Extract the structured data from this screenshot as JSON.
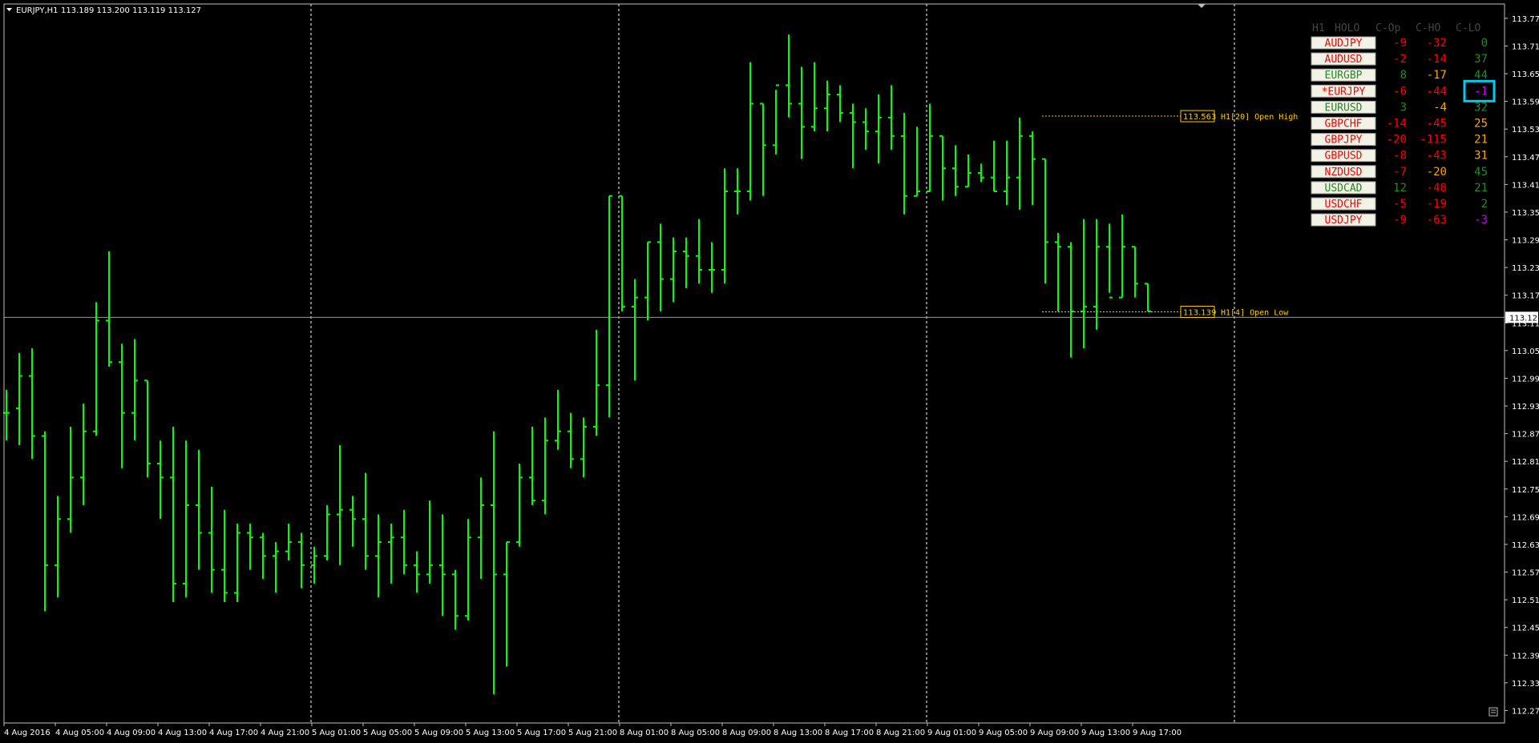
{
  "window": {
    "symbol_caption": "EURJPY,H1",
    "ohlc_caption": "113.189 113.200 113.119 113.127"
  },
  "colors": {
    "background": "#000000",
    "bar": "#00ff00",
    "grid": "#ffffff",
    "axis_text": "#ffffff",
    "level": "#ffcc00",
    "frame": "#c0c0c0",
    "pos": "#228b22",
    "neg": "#ff0000",
    "mid": "#ffa500",
    "violet": "#cc00ff",
    "highlight": "#00ccee"
  },
  "chart_data": {
    "type": "ohlc",
    "ylim": [
      112.248,
      113.806
    ],
    "yticks": [
      "113.775",
      "113.715",
      "113.655",
      "113.595",
      "113.535",
      "113.475",
      "113.415",
      "113.355",
      "113.295",
      "113.235",
      "113.175",
      "113.115",
      "113.055",
      "112.995",
      "112.935",
      "112.875",
      "112.815",
      "112.755",
      "112.695",
      "112.635",
      "112.575",
      "112.515",
      "112.455",
      "112.395",
      "112.335",
      "112.275"
    ],
    "current_price": "113.127",
    "xticks": [
      "4 Aug 2016",
      "4 Aug 05:00",
      "4 Aug 09:00",
      "4 Aug 13:00",
      "4 Aug 17:00",
      "4 Aug 21:00",
      "5 Aug 01:00",
      "5 Aug 05:00",
      "5 Aug 09:00",
      "5 Aug 13:00",
      "5 Aug 17:00",
      "5 Aug 21:00",
      "8 Aug 01:00",
      "8 Aug 05:00",
      "8 Aug 09:00",
      "8 Aug 13:00",
      "8 Aug 17:00",
      "8 Aug 21:00",
      "9 Aug 01:00",
      "9 Aug 05:00",
      "9 Aug 09:00",
      "9 Aug 13:00",
      "9 Aug 17:00"
    ],
    "separators": [
      24,
      48,
      72,
      96
    ],
    "bars": [
      [
        112.92,
        112.97,
        112.86,
        112.92
      ],
      [
        112.93,
        113.05,
        112.85,
        113.0
      ],
      [
        113.0,
        113.06,
        112.82,
        112.87
      ],
      [
        112.87,
        112.88,
        112.49,
        112.59
      ],
      [
        112.59,
        112.74,
        112.52,
        112.69
      ],
      [
        112.69,
        112.89,
        112.66,
        112.78
      ],
      [
        112.78,
        112.94,
        112.72,
        112.88
      ],
      [
        112.88,
        113.16,
        112.87,
        113.12
      ],
      [
        113.12,
        113.27,
        113.02,
        113.03
      ],
      [
        113.03,
        113.07,
        112.8,
        112.92
      ],
      [
        112.92,
        113.08,
        112.86,
        112.99
      ],
      [
        112.99,
        112.99,
        112.78,
        112.81
      ],
      [
        112.81,
        112.86,
        112.69,
        112.78
      ],
      [
        112.78,
        112.89,
        112.51,
        112.55
      ],
      [
        112.55,
        112.86,
        112.52,
        112.72
      ],
      [
        112.72,
        112.84,
        112.58,
        112.66
      ],
      [
        112.66,
        112.76,
        112.53,
        112.58
      ],
      [
        112.58,
        112.71,
        112.51,
        112.53
      ],
      [
        112.53,
        112.68,
        112.51,
        112.66
      ],
      [
        112.66,
        112.68,
        112.58,
        112.65
      ],
      [
        112.65,
        112.66,
        112.56,
        112.61
      ],
      [
        112.61,
        112.64,
        112.53,
        112.62
      ],
      [
        112.62,
        112.68,
        112.6,
        112.64
      ],
      [
        112.64,
        112.66,
        112.54,
        112.59
      ],
      [
        112.59,
        112.63,
        112.55,
        112.61
      ],
      [
        112.61,
        112.72,
        112.6,
        112.7
      ],
      [
        112.7,
        112.85,
        112.59,
        112.71
      ],
      [
        112.71,
        112.74,
        112.63,
        112.69
      ],
      [
        112.69,
        112.79,
        112.58,
        112.61
      ],
      [
        112.61,
        112.7,
        112.52,
        112.64
      ],
      [
        112.64,
        112.68,
        112.55,
        112.65
      ],
      [
        112.65,
        112.71,
        112.57,
        112.59
      ],
      [
        112.59,
        112.62,
        112.53,
        112.57
      ],
      [
        112.57,
        112.73,
        112.55,
        112.59
      ],
      [
        112.59,
        112.7,
        112.48,
        112.57
      ],
      [
        112.57,
        112.58,
        112.45,
        112.48
      ],
      [
        112.48,
        112.69,
        112.47,
        112.65
      ],
      [
        112.65,
        112.78,
        112.56,
        112.72
      ],
      [
        112.72,
        112.88,
        112.31,
        112.57
      ],
      [
        112.57,
        112.64,
        112.37,
        112.64
      ],
      [
        112.64,
        112.81,
        112.63,
        112.78
      ],
      [
        112.78,
        112.89,
        112.72,
        112.73
      ],
      [
        112.73,
        112.91,
        112.7,
        112.86
      ],
      [
        112.86,
        112.97,
        112.84,
        112.88
      ],
      [
        112.88,
        112.92,
        112.8,
        112.82
      ],
      [
        112.82,
        112.91,
        112.78,
        112.89
      ],
      [
        112.89,
        113.1,
        112.87,
        112.98
      ],
      [
        112.98,
        113.39,
        112.91,
        113.39
      ],
      [
        113.39,
        113.39,
        113.14,
        113.15
      ],
      [
        113.15,
        113.21,
        112.99,
        113.17
      ],
      [
        113.17,
        113.29,
        113.12,
        113.29
      ],
      [
        113.29,
        113.33,
        113.14,
        113.21
      ],
      [
        113.21,
        113.3,
        113.16,
        113.27
      ],
      [
        113.27,
        113.3,
        113.19,
        113.26
      ],
      [
        113.26,
        113.34,
        113.2,
        113.23
      ],
      [
        113.23,
        113.29,
        113.18,
        113.23
      ],
      [
        113.23,
        113.45,
        113.2,
        113.4
      ],
      [
        113.4,
        113.45,
        113.35,
        113.4
      ],
      [
        113.4,
        113.68,
        113.38,
        113.59
      ],
      [
        113.59,
        113.59,
        113.39,
        113.5
      ],
      [
        113.5,
        113.62,
        113.48,
        113.63
      ],
      [
        113.63,
        113.74,
        113.56,
        113.59
      ],
      [
        113.59,
        113.67,
        113.47,
        113.54
      ],
      [
        113.54,
        113.68,
        113.53,
        113.58
      ],
      [
        113.58,
        113.64,
        113.53,
        113.61
      ],
      [
        113.61,
        113.63,
        113.55,
        113.57
      ],
      [
        113.57,
        113.59,
        113.45,
        113.55
      ],
      [
        113.55,
        113.58,
        113.49,
        113.53
      ],
      [
        113.53,
        113.61,
        113.46,
        113.56
      ],
      [
        113.56,
        113.63,
        113.49,
        113.52
      ],
      [
        113.52,
        113.57,
        113.35,
        113.39
      ],
      [
        113.39,
        113.54,
        113.39,
        113.4
      ],
      [
        113.4,
        113.59,
        113.4,
        113.52
      ],
      [
        113.52,
        113.52,
        113.38,
        113.45
      ],
      [
        113.45,
        113.5,
        113.39,
        113.41
      ],
      [
        113.41,
        113.48,
        113.41,
        113.44
      ],
      [
        113.44,
        113.46,
        113.42,
        113.43
      ],
      [
        113.43,
        113.51,
        113.4,
        113.4
      ],
      [
        113.4,
        113.51,
        113.37,
        113.43
      ],
      [
        113.43,
        113.56,
        113.36,
        113.52
      ],
      [
        113.52,
        113.53,
        113.37,
        113.47
      ],
      [
        113.47,
        113.47,
        113.2,
        113.29
      ],
      [
        113.29,
        113.31,
        113.14,
        113.28
      ],
      [
        113.28,
        113.29,
        113.04,
        113.14
      ],
      [
        113.14,
        113.34,
        113.06,
        113.15
      ],
      [
        113.15,
        113.34,
        113.1,
        113.28
      ],
      [
        113.28,
        113.33,
        113.18,
        113.17
      ],
      [
        113.17,
        113.35,
        113.17,
        113.28
      ],
      [
        113.28,
        113.28,
        113.17,
        113.2
      ],
      [
        113.2,
        113.2,
        113.14,
        113.14
      ]
    ],
    "levels": [
      {
        "price": 113.563,
        "label": "113.563",
        "name": "H1[20] Open High"
      },
      {
        "price": 113.139,
        "label": "113.139",
        "name": "H1[4] Open Low"
      }
    ],
    "table": {
      "headers": [
        "H1",
        "HOLO",
        "C-Op",
        "C-HO",
        "C-LO"
      ],
      "highlight_row": 3,
      "rows": [
        {
          "pair": "AUDJPY",
          "pair_color": "neg",
          "c_op": "-9",
          "op_color": "neg",
          "c_ho": "-32",
          "ho_color": "neg",
          "c_lo": "0",
          "lo_color": "pos"
        },
        {
          "pair": "AUDUSD",
          "pair_color": "neg",
          "c_op": "-2",
          "op_color": "neg",
          "c_ho": "-14",
          "ho_color": "neg",
          "c_lo": "37",
          "lo_color": "pos"
        },
        {
          "pair": "EURGBP",
          "pair_color": "pos",
          "c_op": "8",
          "op_color": "pos",
          "c_ho": "-17",
          "ho_color": "mid",
          "c_lo": "44",
          "lo_color": "pos"
        },
        {
          "pair": "*EURJPY",
          "pair_color": "neg",
          "c_op": "-6",
          "op_color": "neg",
          "c_ho": "-44",
          "ho_color": "neg",
          "c_lo": "-1",
          "lo_color": "violet"
        },
        {
          "pair": "EURUSD",
          "pair_color": "pos",
          "c_op": "3",
          "op_color": "pos",
          "c_ho": "-4",
          "ho_color": "mid",
          "c_lo": "32",
          "lo_color": "pos"
        },
        {
          "pair": "GBPCHF",
          "pair_color": "neg",
          "c_op": "-14",
          "op_color": "neg",
          "c_ho": "-45",
          "ho_color": "neg",
          "c_lo": "25",
          "lo_color": "mid"
        },
        {
          "pair": "GBPJPY",
          "pair_color": "neg",
          "c_op": "-20",
          "op_color": "neg",
          "c_ho": "-115",
          "ho_color": "neg",
          "c_lo": "21",
          "lo_color": "mid"
        },
        {
          "pair": "GBPUSD",
          "pair_color": "neg",
          "c_op": "-8",
          "op_color": "neg",
          "c_ho": "-43",
          "ho_color": "neg",
          "c_lo": "31",
          "lo_color": "mid"
        },
        {
          "pair": "NZDUSD",
          "pair_color": "neg",
          "c_op": "-7",
          "op_color": "neg",
          "c_ho": "-20",
          "ho_color": "mid",
          "c_lo": "45",
          "lo_color": "pos"
        },
        {
          "pair": "USDCAD",
          "pair_color": "pos",
          "c_op": "12",
          "op_color": "pos",
          "c_ho": "-48",
          "ho_color": "neg",
          "c_lo": "21",
          "lo_color": "pos"
        },
        {
          "pair": "USDCHF",
          "pair_color": "neg",
          "c_op": "-5",
          "op_color": "neg",
          "c_ho": "-19",
          "ho_color": "neg",
          "c_lo": "2",
          "lo_color": "pos"
        },
        {
          "pair": "USDJPY",
          "pair_color": "neg",
          "c_op": "-9",
          "op_color": "neg",
          "c_ho": "-63",
          "ho_color": "neg",
          "c_lo": "-3",
          "lo_color": "violet"
        }
      ]
    }
  }
}
